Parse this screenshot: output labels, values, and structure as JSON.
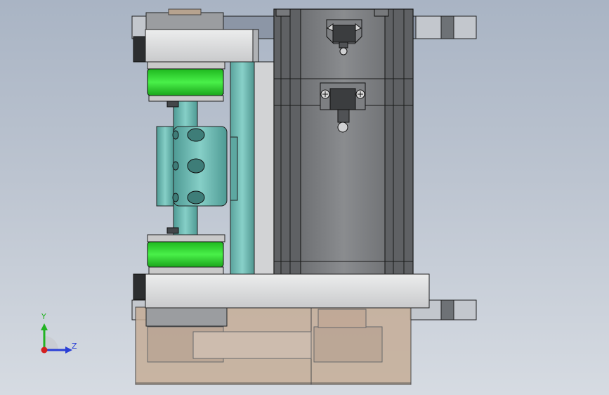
{
  "viewport": {
    "background_top": "#a9b4c4",
    "background_bottom": "#d6dbe2"
  },
  "colors": {
    "plate_light": "#d9dadc",
    "plate_dark": "#8b8d90",
    "body_dark": "#6f7174",
    "body_mid": "#8a8c8f",
    "edge": "#1e1e1e",
    "rail": "#73bdb6",
    "coupling": "#6fb9b2",
    "pulley_green": "#2fdc2f",
    "transparent_cover": "#c9b29e",
    "triad_x": "#d42020",
    "triad_y": "#22b322",
    "triad_z": "#2a3fd6"
  },
  "triad": {
    "y_label": "Y",
    "z_label": "Z",
    "x_icon": "x-axis-dot",
    "y_icon": "y-axis-arrow",
    "z_icon": "z-axis-arrow"
  }
}
